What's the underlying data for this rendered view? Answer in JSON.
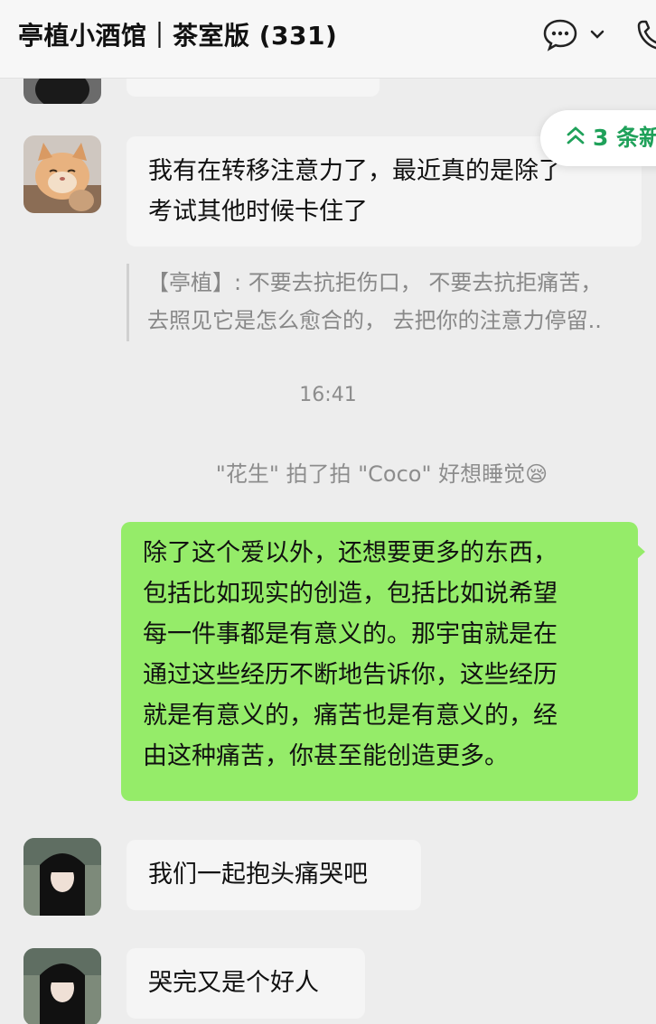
{
  "header": {
    "title": "亭植小酒馆｜茶室版 (331)"
  },
  "new_messages": {
    "label": "3 条新"
  },
  "messages": [
    {
      "text_lines": [
        "我有在转移注意力了，最近真的是除了",
        "考试其他时候卡住了"
      ],
      "quote_lines": [
        "【亭植】: 不要去抗拒伤口， 不要去抗拒痛苦，",
        "去照见它是怎么愈合的， 去把你的注意力停留.."
      ]
    },
    {
      "text_lines": [
        "除了这个爱以外，还想要更多的东西，",
        "包括比如现实的创造，包括比如说希望",
        "每一件事都是有意义的。那宇宙就是在",
        "通过这些经历不断地告诉你，这些经历",
        "就是有意义的，痛苦也是有意义的，经",
        "由这种痛苦，你甚至能创造更多。"
      ]
    },
    {
      "text": "我们一起抱头痛哭吧"
    },
    {
      "text": "哭完又是个好人"
    }
  ],
  "time_label": "16:41",
  "system_message": "\"花生\" 拍了拍 \"Coco\" 好想睡觉😪",
  "colors": {
    "accent_green": "#1fa15a",
    "bubble_green": "#95ec69",
    "bubble_gray": "#f5f5f5",
    "background": "#ededed"
  },
  "icons": [
    "chat-bubble-icon",
    "chevron-down-icon",
    "phone-icon",
    "double-chevron-up-icon"
  ]
}
